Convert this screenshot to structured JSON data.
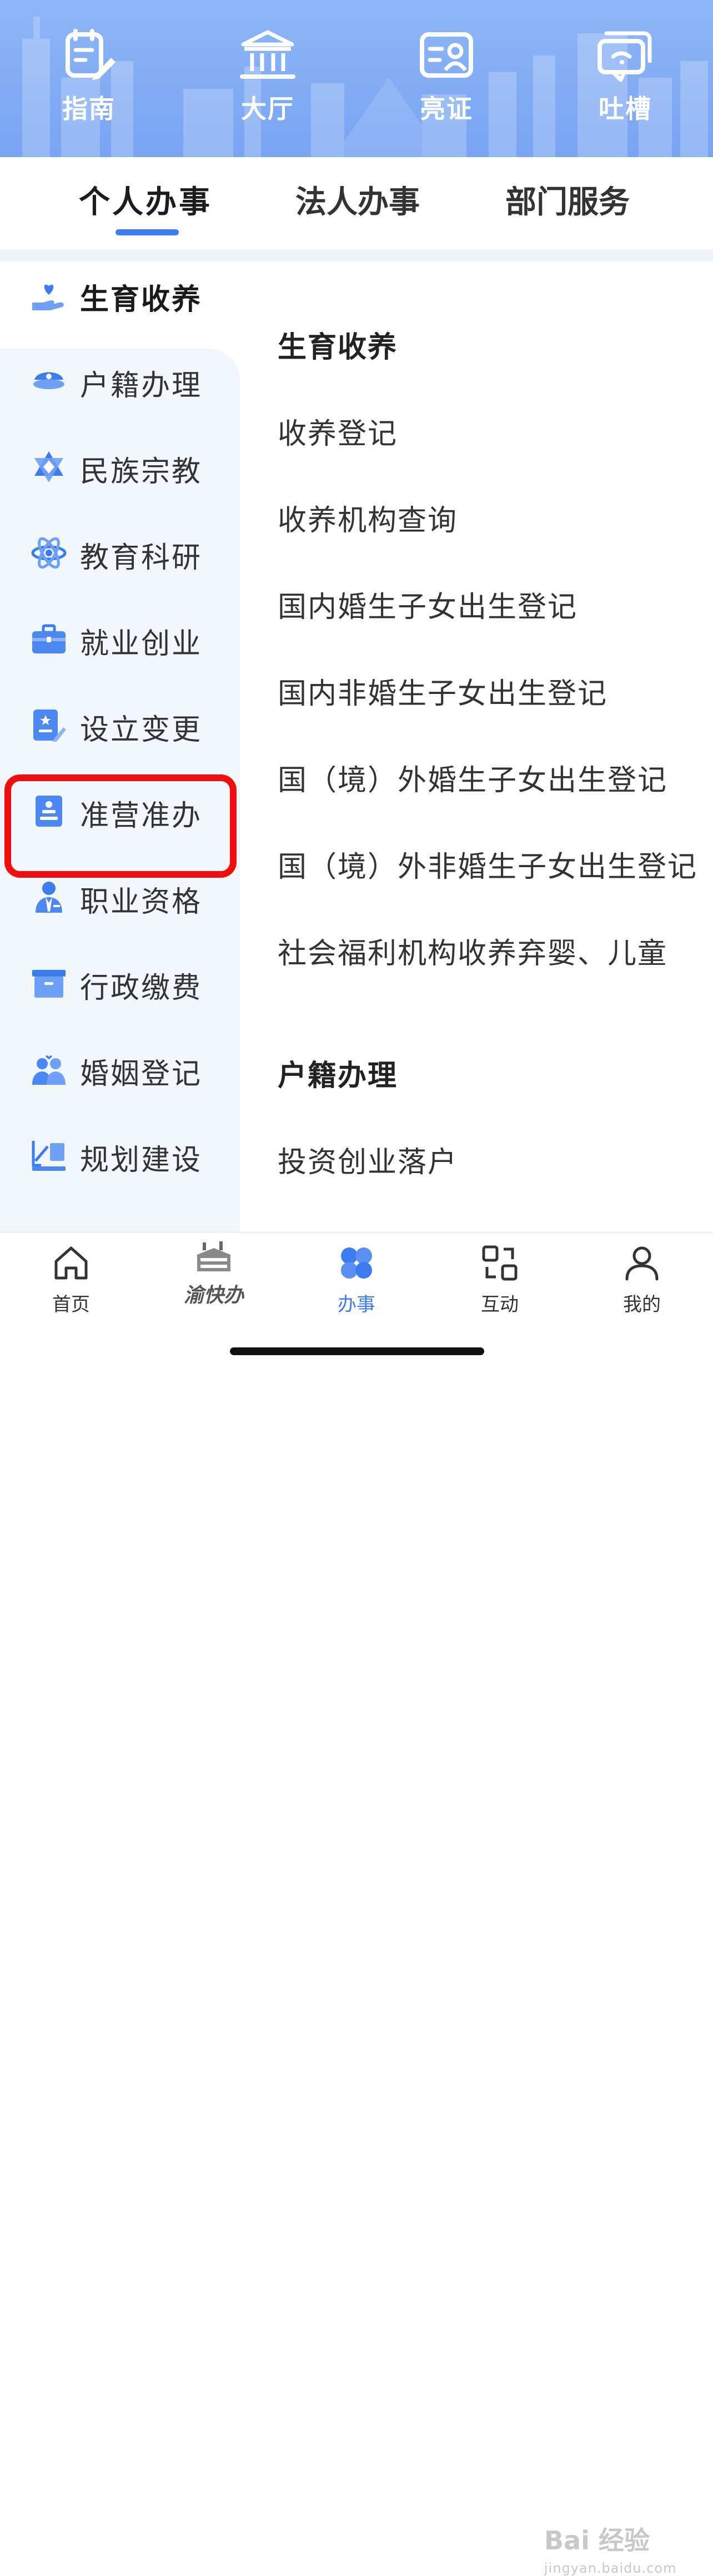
{
  "header": {
    "quick_links": [
      {
        "label": "指南",
        "icon": "guide-icon"
      },
      {
        "label": "大厅",
        "icon": "hall-icon"
      },
      {
        "label": "亮证",
        "icon": "id-card-icon"
      },
      {
        "label": "吐槽",
        "icon": "feedback-icon"
      }
    ]
  },
  "tabs": [
    {
      "label": "个人办事",
      "active": true
    },
    {
      "label": "法人办事",
      "active": false
    },
    {
      "label": "部门服务",
      "active": false
    }
  ],
  "sidebar": {
    "items": [
      {
        "label": "生育收养",
        "icon": "child-care-icon",
        "selected": true
      },
      {
        "label": "户籍办理",
        "icon": "police-cap-icon"
      },
      {
        "label": "民族宗教",
        "icon": "star-of-david-icon"
      },
      {
        "label": "教育科研",
        "icon": "atom-icon",
        "highlighted": true
      },
      {
        "label": "就业创业",
        "icon": "briefcase-icon"
      },
      {
        "label": "设立变更",
        "icon": "document-edit-icon"
      },
      {
        "label": "准营准办",
        "icon": "stamp-icon"
      },
      {
        "label": "职业资格",
        "icon": "professional-icon"
      },
      {
        "label": "行政缴费",
        "icon": "archive-box-icon"
      },
      {
        "label": "婚姻登记",
        "icon": "couple-icon"
      },
      {
        "label": "规划建设",
        "icon": "ruler-icon"
      }
    ]
  },
  "content": {
    "sections": [
      {
        "title": "生育收养",
        "items": [
          "收养登记",
          "收养机构查询",
          "国内婚生子女出生登记",
          "国内非婚生子女出生登记",
          "国（境）外婚生子女出生登记",
          "国（境）外非婚生子女出生登记",
          "社会福利机构收养弃婴、儿童"
        ]
      },
      {
        "title": "户籍办理",
        "items": [
          "投资创业落户"
        ]
      }
    ]
  },
  "bottom_nav": {
    "items": [
      {
        "label": "首页",
        "icon": "home-icon"
      },
      {
        "label": "渝快办",
        "icon": "yukuaiban-logo"
      },
      {
        "label": "办事",
        "icon": "clover-icon",
        "active": true
      },
      {
        "label": "互动",
        "icon": "interact-icon"
      },
      {
        "label": "我的",
        "icon": "user-icon"
      }
    ]
  },
  "watermark": {
    "text": "Bai 经验",
    "sub": "jingyan.baidu.com"
  },
  "colors": {
    "accent": "#3d7bf0",
    "banner": "#8fb6f6",
    "sidebar_bg": "#f2f6fd",
    "highlight": "#f20d0d"
  }
}
